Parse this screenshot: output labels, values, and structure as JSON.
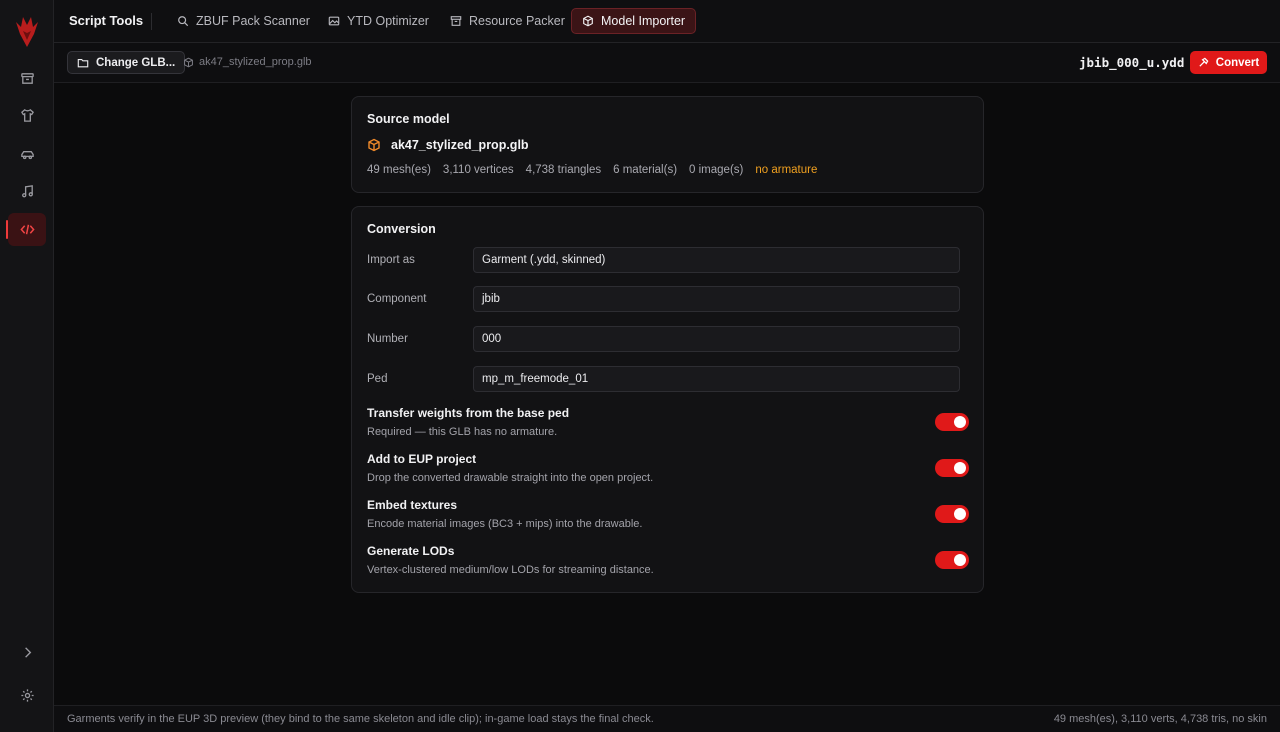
{
  "app": {
    "title": "Script Tools"
  },
  "tabs": [
    {
      "label": "ZBUF Pack Scanner",
      "icon": "search-icon"
    },
    {
      "label": "YTD Optimizer",
      "icon": "image-icon"
    },
    {
      "label": "Resource Packer",
      "icon": "archive-icon"
    },
    {
      "label": "Model Importer",
      "icon": "cube-icon",
      "active": true
    }
  ],
  "sidebar": {
    "items": [
      {
        "icon": "archive-icon"
      },
      {
        "icon": "shirt-icon"
      },
      {
        "icon": "car-icon"
      },
      {
        "icon": "music-icon"
      },
      {
        "icon": "code-icon",
        "active": true
      }
    ],
    "bottom": [
      {
        "icon": "chevron-right-icon"
      },
      {
        "icon": "gear-icon"
      }
    ]
  },
  "toolbar": {
    "change_label": "Change GLB...",
    "file_name": "ak47_stylized_prop.glb",
    "output_name": "jbib_000_u.ydd",
    "convert_label": "Convert"
  },
  "source": {
    "title": "Source model",
    "file": "ak47_stylized_prop.glb",
    "stats": [
      "49 mesh(es)",
      "3,110 vertices",
      "4,738 triangles",
      "6 material(s)",
      "0 image(s)"
    ],
    "warning": "no armature"
  },
  "conversion": {
    "title": "Conversion",
    "fields": [
      {
        "label": "Import as",
        "value": "Garment (.ydd, skinned)"
      },
      {
        "label": "Component",
        "value": "jbib"
      },
      {
        "label": "Number",
        "value": "000"
      },
      {
        "label": "Ped",
        "value": "mp_m_freemode_01"
      }
    ],
    "toggles": [
      {
        "title": "Transfer weights from the base ped",
        "desc": "Required — this GLB has no armature.",
        "on": true
      },
      {
        "title": "Add to EUP project",
        "desc": "Drop the converted drawable straight into the open project.",
        "on": true
      },
      {
        "title": "Embed textures",
        "desc": "Encode material images (BC3 + mips) into the drawable.",
        "on": true
      },
      {
        "title": "Generate LODs",
        "desc": "Vertex-clustered medium/low LODs for streaming distance.",
        "on": true
      }
    ]
  },
  "status": {
    "left": "Garments verify in the EUP 3D preview (they bind to the same skeleton and idle clip); in-game load stays the final check.",
    "right": "49 mesh(es), 3,110 verts, 4,738 tris, no skin"
  },
  "colors": {
    "accent": "#e01919",
    "warning": "#f0a020",
    "background": "#0b0b0c"
  }
}
